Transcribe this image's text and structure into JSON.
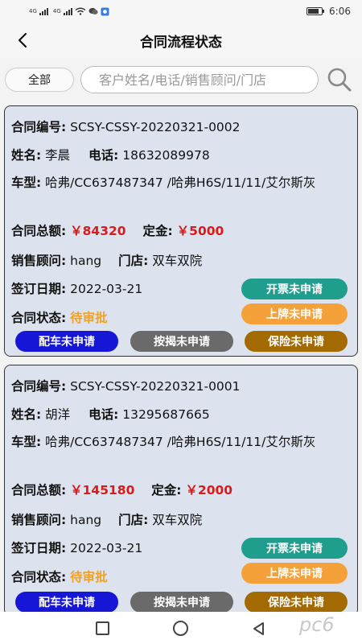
{
  "status_bar": {
    "time": "6:06",
    "signal_label_1": "4G",
    "signal_label_2": "4G"
  },
  "header": {
    "title": "合同流程状态"
  },
  "filter": {
    "label": "全部"
  },
  "search": {
    "placeholder": "客户姓名/电话/销售顾问/门店"
  },
  "labels": {
    "contract_no": "合同编号:",
    "name": "姓名:",
    "phone": "电话:",
    "model": "车型:",
    "total": "合同总额:",
    "deposit": "定金:",
    "consultant": "销售顾问:",
    "store": "门店:",
    "sign_date": "签订日期:",
    "status": "合同状态:"
  },
  "contracts": [
    {
      "contract_no": "SCSY-CSSY-20220321-0002",
      "name": "李晨",
      "phone": "18632089978",
      "model": "哈弗/CC637487347 /哈弗H6S/11/11/艾尔斯灰",
      "total": "￥84320",
      "deposit": "￥5000",
      "consultant": "hang",
      "store": "双车双院",
      "sign_date": "2022-03-21",
      "status": "待审批",
      "buttons": {
        "invoice": "开票未申请",
        "plate": "上牌未申请",
        "allocate": "配车未申请",
        "mortgage": "按揭未申请",
        "insurance": "保险未申请"
      }
    },
    {
      "contract_no": "SCSY-CSSY-20220321-0001",
      "name": "胡洋",
      "phone": "13295687665",
      "model": "哈弗/CC637487347 /哈弗H6S/11/11/艾尔斯灰",
      "total": "￥145180",
      "deposit": "￥2000",
      "consultant": "hang",
      "store": "双车双院",
      "sign_date": "2022-03-21",
      "status": "待审批",
      "buttons": {
        "invoice": "开票未申请",
        "plate": "上牌未申请",
        "allocate": "配车未申请",
        "mortgage": "按揭未申请",
        "insurance": "保险未申请"
      }
    }
  ],
  "watermark": "pc6",
  "colors": {
    "money": "#d81b1b",
    "status": "#f2a020",
    "teal_button": "#1f9e8e",
    "orange_button": "#f5a13a",
    "blue_button": "#1616d6",
    "gray_button": "#6a6a6a",
    "brown_button": "#a26a00",
    "card_bg": "#dde3ee"
  },
  "icons": {
    "back": "back-arrow-icon",
    "search": "search-icon",
    "nav_recent": "square-icon",
    "nav_home": "circle-icon",
    "nav_back": "triangle-back-icon"
  }
}
